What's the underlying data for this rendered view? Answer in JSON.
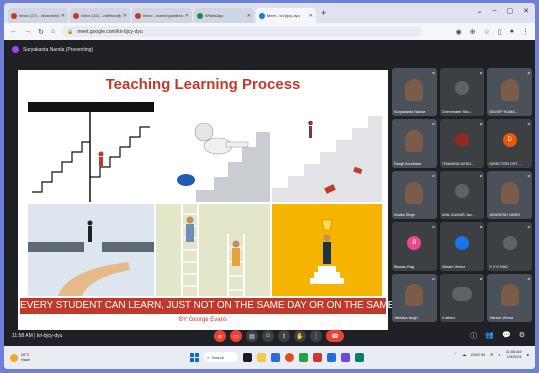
{
  "browser": {
    "tabs": [
      {
        "label": "Inbox (27) - vikasrishi@gmai",
        "active": false
      },
      {
        "label": "Inbox (32) - vaibhav@gmail.",
        "active": false
      },
      {
        "label": "Inbox - learningandteaching",
        "active": false
      },
      {
        "label": "WhatsApp",
        "active": false
      },
      {
        "label": "Meet - kri-bjcy-dyu",
        "active": true
      }
    ],
    "url": "meet.google.com/kri-bjcy-dyu"
  },
  "meet": {
    "presenter_label": "Suryakanta Nanda (Presenting)",
    "time_code": "11:58 AM  |  kri-bjcy-dyu",
    "participants": [
      {
        "name": "Suryakanta Nanda",
        "kind": "video"
      },
      {
        "name": "Chemmater Shu...",
        "kind": "avatar",
        "color": "#5f6368",
        "initial": ""
      },
      {
        "name": "DILEEP KUMA...",
        "kind": "video"
      },
      {
        "name": "Ranjit Kundhare",
        "kind": "video"
      },
      {
        "name": "TRAINING ASSO...",
        "kind": "avatar",
        "color": "#8e2b1f",
        "initial": ""
      },
      {
        "name": "DIRECTOR DST ...",
        "kind": "avatar",
        "color": "#e8590c",
        "initial": "D"
      },
      {
        "name": "Kavita Singh",
        "kind": "video"
      },
      {
        "name": "ANIL KUMAR Jav...",
        "kind": "avatar",
        "color": "#5f6368",
        "initial": ""
      },
      {
        "name": "ARUNESH VAISH",
        "kind": "video"
      },
      {
        "name": "Biswas Rag",
        "kind": "avatar",
        "color": "#e84a8a",
        "initial": "B"
      },
      {
        "name": "Vikram Verma",
        "kind": "avatar",
        "color": "#1a73e8",
        "initial": ""
      },
      {
        "name": "V V K RAO",
        "kind": "avatar",
        "color": "#5f6368",
        "initial": ""
      },
      {
        "name": "Jitendra singh",
        "kind": "video"
      },
      {
        "name": "4 others",
        "kind": "others"
      },
      {
        "name": "Vikram Verma",
        "kind": "video"
      }
    ]
  },
  "slide": {
    "title": "Teaching Learning Process",
    "banner": "EVERY STUDENT CAN LEARN, JUST NOT ON THE SAME DAY OR ON THE SAME WAY.",
    "byline": "BY George Evans"
  },
  "taskbar": {
    "weather_temp": "28°C",
    "weather_desc": "Haze",
    "search_placeholder": "Search",
    "lang": "ENG IN",
    "time": "11:58 AM",
    "date": "1/5/2024"
  },
  "colors": {
    "title_red": "#c0392b",
    "meet_bg": "#202124",
    "end_call": "#ea4335"
  }
}
